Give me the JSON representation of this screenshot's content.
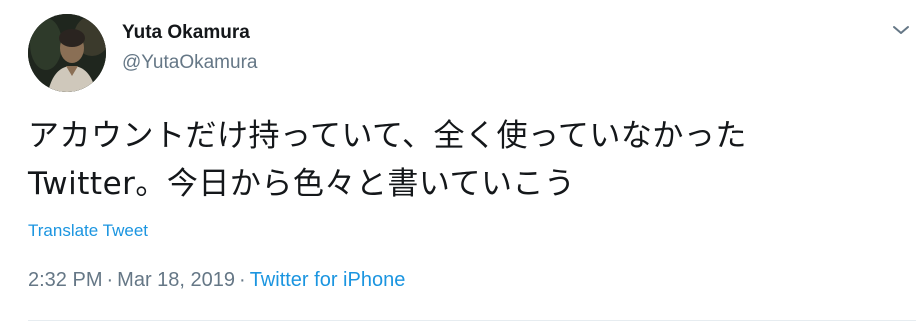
{
  "user": {
    "name": "Yuta Okamura",
    "handle": "@YutaOkamura"
  },
  "tweet": {
    "text": "アカウントだけ持っていて、全く使っていなかった\nTwitter。今日から色々と書いていこう",
    "translate_label": "Translate Tweet",
    "time": "2:32 PM",
    "separator1": "·",
    "date": "Mar 18, 2019",
    "separator2": "·",
    "source": "Twitter for iPhone"
  },
  "icons": {
    "caret": "chevron-down-icon",
    "avatar": "avatar"
  },
  "colors": {
    "link": "#1b95e0",
    "secondary_text": "#657786",
    "primary_text": "#14171a"
  }
}
